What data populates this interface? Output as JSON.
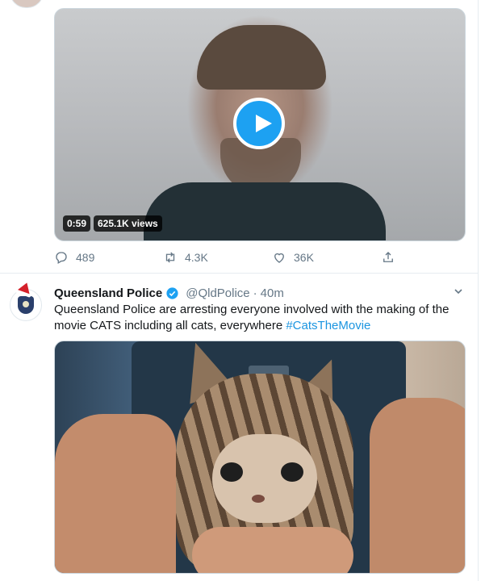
{
  "tweet1": {
    "video": {
      "duration": "0:59",
      "views": "625.1K views"
    },
    "actions": {
      "replies": "489",
      "retweets": "4.3K",
      "likes": "36K"
    }
  },
  "tweet2": {
    "display_name": "Queensland Police",
    "handle": "@QldPolice",
    "separator": "·",
    "time": "40m",
    "text_before": "Queensland Police are arresting everyone involved with the making of the movie CATS including all cats, everywhere ",
    "hashtag": "#CatsTheMovie"
  },
  "colors": {
    "accent": "#1da1f2",
    "link": "#1b95e0",
    "muted": "#657786"
  },
  "icons": [
    "reply-icon",
    "retweet-icon",
    "like-icon",
    "share-icon",
    "play-icon",
    "verified-badge-icon",
    "caret-down-icon"
  ]
}
